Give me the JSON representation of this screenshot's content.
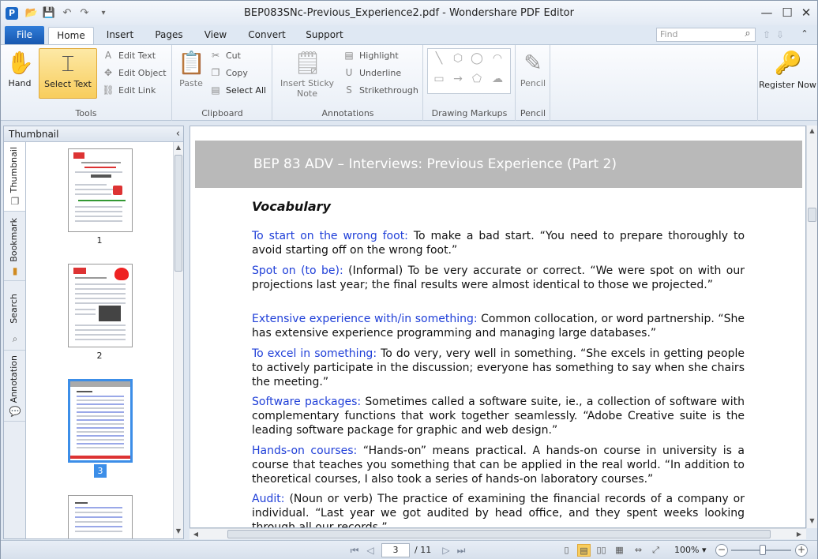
{
  "titlebar": {
    "title": "BEP083SNc-Previous_Experience2.pdf - Wondershare PDF Editor",
    "minimize": "—",
    "maximize": "☐",
    "close": "✕"
  },
  "tabs": {
    "file": "File",
    "items": [
      "Home",
      "Insert",
      "Pages",
      "View",
      "Convert",
      "Support"
    ],
    "active": "Home"
  },
  "find": {
    "placeholder": "Find"
  },
  "ribbon": {
    "tools": {
      "label": "Tools",
      "hand": "Hand",
      "select_text": "Select Text",
      "edit_text": "Edit Text",
      "edit_object": "Edit Object",
      "edit_link": "Edit Link"
    },
    "clipboard": {
      "label": "Clipboard",
      "paste": "Paste",
      "cut": "Cut",
      "copy": "Copy",
      "select_all": "Select All"
    },
    "annotations": {
      "label": "Annotations",
      "insert_sticky_note_line1": "Insert Sticky",
      "insert_sticky_note_line2": "Note",
      "highlight": "Highlight",
      "underline": "Underline",
      "strikethrough": "Strikethrough"
    },
    "drawing": {
      "label": "Drawing Markups"
    },
    "pencil": {
      "label": "Pencil",
      "pencil": "Pencil"
    },
    "register": {
      "label": "Register Now"
    }
  },
  "sidebar": {
    "title": "Thumbnail",
    "vtabs": [
      "Thumbnail",
      "Bookmark",
      "Search",
      "Annotation"
    ],
    "pages": [
      "1",
      "2",
      "3"
    ],
    "selected_page": "3"
  },
  "document": {
    "header": "BEP 83 ADV – Interviews: Previous Experience (Part 2)",
    "section_title": "Vocabulary",
    "entries": [
      {
        "term": "To start on the wrong foot:",
        "text": " To make a bad start. “You need to prepare thoroughly to avoid starting off on the wrong foot.”"
      },
      {
        "term": "Spot on (to be):",
        "text": " (Informal) To be very accurate or correct. “We were spot on with our projections last year; the final results were almost identical to those we projected.”"
      },
      {
        "term": "Extensive experience with/in something:",
        "text": " Common collocation, or word partnership. “She has extensive experience programming and managing large databases.”"
      },
      {
        "term": "To excel in something:",
        "text": " To do very, very well in something. “She excels in getting people to actively participate in the discussion; everyone has something to say when she chairs the meeting.”"
      },
      {
        "term": "Software packages:",
        "text": " Sometimes called a software suite, ie., a collection of software with complementary functions that work together seamlessly. “Adobe Creative suite is the leading software package for graphic and web design.”"
      },
      {
        "term": "Hands-on courses:",
        "text": " “Hands-on” means practical. A hands-on course in university is a course that teaches you something that can be applied in the real world. “In addition to theoretical courses, I also took a series of hands-on laboratory courses.”"
      },
      {
        "term": "Audit:",
        "text": " (Noun or verb) The practice of examining the financial records of a company or individual. “Last year we got audited by head office, and they spent weeks looking through all our records.”"
      }
    ]
  },
  "statusbar": {
    "current_page": "3",
    "total_pages": "/ 11",
    "zoom": "100%",
    "zoom_minus": "−",
    "zoom_plus": "+"
  }
}
